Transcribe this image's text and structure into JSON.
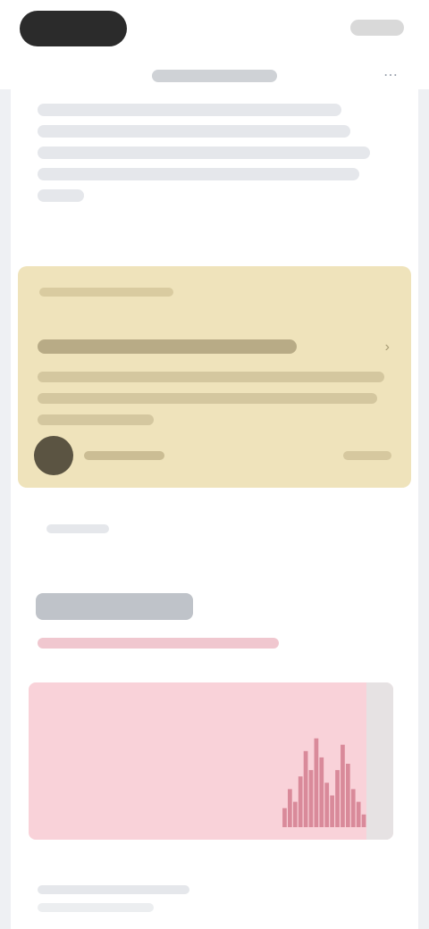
{
  "status_bar": {
    "pill_label": "",
    "right_label": ""
  },
  "header": {
    "title": "",
    "menu_icon": "more-icon"
  },
  "intro": {
    "text": ""
  },
  "featured_card": {
    "eyebrow": "",
    "title": "",
    "body": "",
    "author": "",
    "meta": "",
    "background_color": "#efe3bb"
  },
  "more_link": {
    "label": ""
  },
  "section": {
    "title": "",
    "subtitle": ""
  },
  "chart_data": {
    "type": "bar",
    "title": "",
    "categories": [],
    "values": [
      0,
      0,
      0,
      0,
      0,
      0,
      0,
      0,
      0,
      0,
      0,
      0,
      0,
      0,
      0,
      0,
      0,
      0,
      0,
      0,
      0,
      0,
      0,
      0,
      0,
      0,
      0,
      0,
      0,
      0,
      0,
      0,
      0,
      0,
      0,
      0,
      0,
      0,
      0,
      0,
      0,
      0,
      0,
      0,
      0,
      0,
      0,
      0,
      3,
      6,
      4,
      8,
      12,
      9,
      14,
      11,
      7,
      5,
      9,
      13,
      10,
      6,
      4,
      2
    ],
    "ylim": [
      0,
      20
    ],
    "grid": false,
    "legend": "none",
    "bar_color": "#d98a9a",
    "background_color": "#f9d2d9"
  },
  "caption": {
    "text": ""
  }
}
